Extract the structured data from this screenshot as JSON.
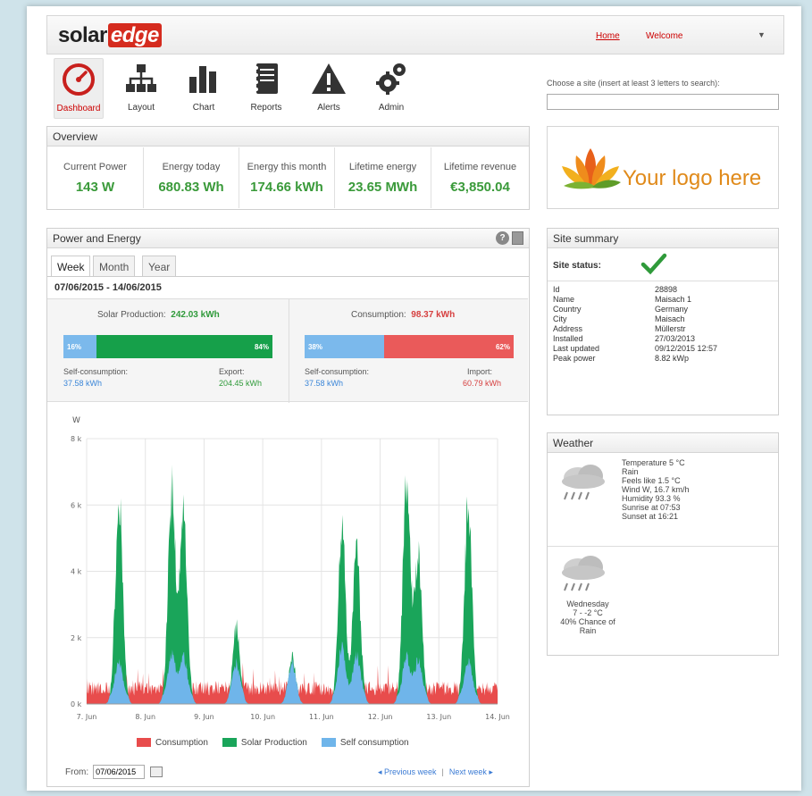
{
  "brand": {
    "solar": "solar",
    "edge": "edge"
  },
  "topnav": {
    "home": "Home",
    "welcome": "Welcome",
    "caret": "▼"
  },
  "menu": [
    {
      "label": "Dashboard"
    },
    {
      "label": "Layout"
    },
    {
      "label": "Chart"
    },
    {
      "label": "Reports"
    },
    {
      "label": "Alerts"
    },
    {
      "label": "Admin"
    }
  ],
  "overview": {
    "title": "Overview",
    "cells": [
      {
        "label": "Current Power",
        "value": "143 W"
      },
      {
        "label": "Energy today",
        "value": "680.83 Wh"
      },
      {
        "label": "Energy this month",
        "value": "174.66 kWh"
      },
      {
        "label": "Lifetime energy",
        "value": "23.65 MWh"
      },
      {
        "label": "Lifetime revenue",
        "value": "€3,850.04"
      }
    ]
  },
  "power_energy": {
    "title": "Power and Energy",
    "tabs": [
      "Week",
      "Month",
      "Year"
    ],
    "range": "07/06/2015 - 14/06/2015",
    "production": {
      "label": "Solar Production:",
      "value": "242.03 kWh",
      "self_pct": "16%",
      "self_frac": 0.16,
      "export_pct": "84%",
      "self_label": "Self-consumption:",
      "self_value": "37.58 kWh",
      "export_label": "Export:",
      "export_value": "204.45 kWh"
    },
    "consumption": {
      "label": "Consumption:",
      "value": "98.37 kWh",
      "self_pct": "38%",
      "self_frac": 0.38,
      "import_pct": "62%",
      "self_label": "Self-consumption:",
      "self_value": "37.58 kWh",
      "import_label": "Import:",
      "import_value": "60.79 kWh"
    },
    "from_label": "From:",
    "from_value": "07/06/2015",
    "prev_week": "◂ Previous week",
    "sep": "|",
    "next_week": "Next week ▸"
  },
  "chart_data": {
    "type": "area",
    "ylabel": "W",
    "ylim": [
      0,
      8000
    ],
    "yticks": [
      "0 k",
      "2 k",
      "4 k",
      "6 k",
      "8 k"
    ],
    "yticks_values": [
      0,
      2000,
      4000,
      6000,
      8000
    ],
    "xticks": [
      "7. Jun",
      "8. Jun",
      "9. Jun",
      "10. Jun",
      "11. Jun",
      "12. Jun",
      "13. Jun",
      "14. Jun"
    ],
    "series": [
      {
        "name": "Consumption",
        "color": "#e84c4c"
      },
      {
        "name": "Solar Production",
        "color": "#1aa55a"
      },
      {
        "name": "Self consumption",
        "color": "#6fb5ea"
      }
    ],
    "peaks": [
      {
        "day": 0.55,
        "solar": 7000,
        "self": 1300
      },
      {
        "day": 1.45,
        "solar": 7200,
        "self": 1500
      },
      {
        "day": 1.65,
        "solar": 6600,
        "self": 1400
      },
      {
        "day": 2.55,
        "solar": 2600,
        "self": 1200
      },
      {
        "day": 3.5,
        "solar": 1600,
        "self": 1200
      },
      {
        "day": 4.35,
        "solar": 5800,
        "self": 1700
      },
      {
        "day": 4.6,
        "solar": 5200,
        "self": 1500
      },
      {
        "day": 5.45,
        "solar": 7700,
        "self": 1400
      },
      {
        "day": 5.65,
        "solar": 5000,
        "self": 1300
      },
      {
        "day": 6.5,
        "solar": 6800,
        "self": 1300
      },
      {
        "day": 7.4,
        "solar": 5900,
        "self": 1500
      }
    ],
    "legend": [
      "Consumption",
      "Solar Production",
      "Self consumption"
    ]
  },
  "site_search": {
    "label": "Choose a site (insert at least 3 letters to search):",
    "placeholder": ""
  },
  "logo_panel": {
    "text": "Your logo here"
  },
  "site_summary": {
    "title": "Site summary",
    "status_label": "Site status:",
    "rows": [
      {
        "k": "Id",
        "v": "28898"
      },
      {
        "k": "Name",
        "v": "Maisach 1"
      },
      {
        "k": "Country",
        "v": "Germany"
      },
      {
        "k": "City",
        "v": "Maisach"
      },
      {
        "k": "Address",
        "v": "Müllerstr"
      },
      {
        "k": "Installed",
        "v": "27/03/2013"
      },
      {
        "k": "Last updated",
        "v": "09/12/2015 12:57"
      },
      {
        "k": "Peak power",
        "v": "8.82 kWp"
      }
    ]
  },
  "weather": {
    "title": "Weather",
    "today": [
      "Temperature 5 °C",
      "Rain",
      "Feels like 1.5 °C",
      "Wind W, 16.7 km/h",
      "Humidity 93.3 %",
      "Sunrise at 07:53",
      "Sunset at 16:21"
    ],
    "forecast": [
      "Wednesday",
      "7 - -2 °C",
      "40% Chance of",
      "Rain"
    ]
  }
}
